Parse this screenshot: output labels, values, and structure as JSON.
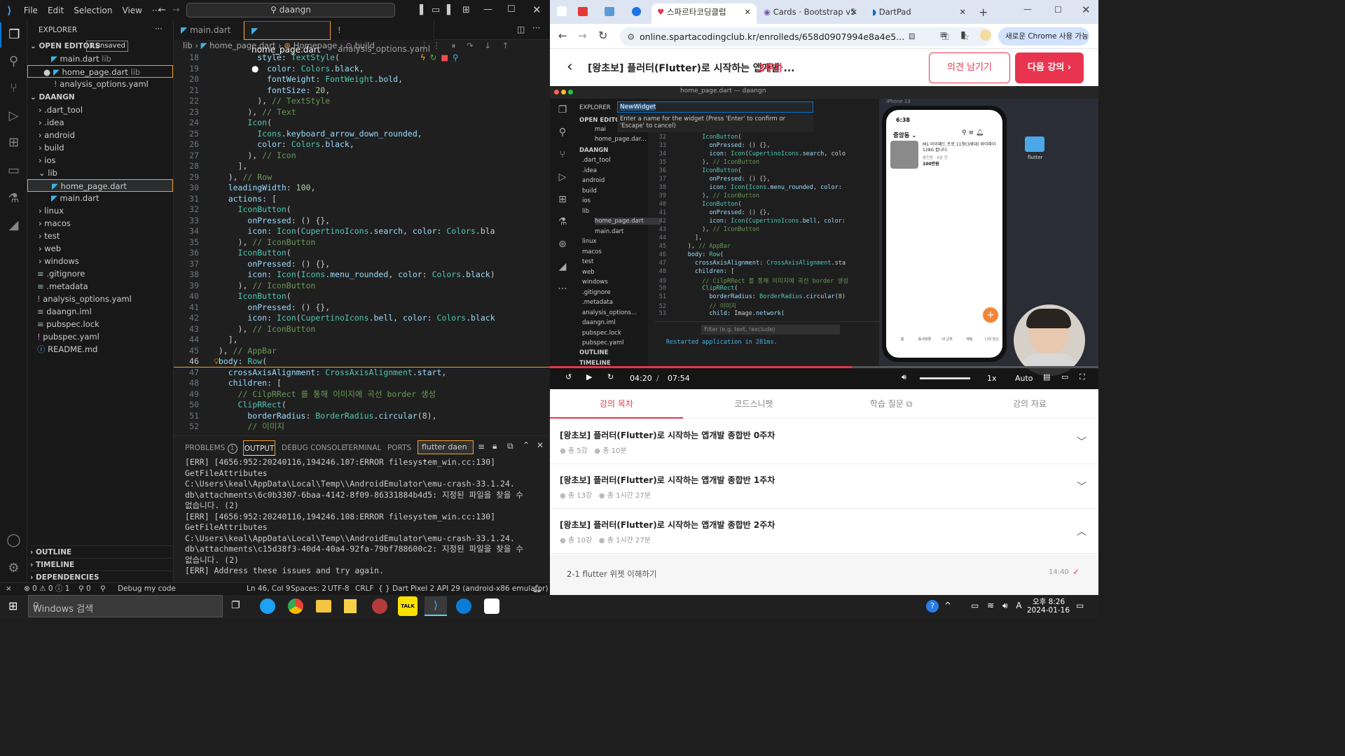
{
  "vscode": {
    "menu": [
      "File",
      "Edit",
      "Selection",
      "View",
      "···"
    ],
    "search": "daangn",
    "explorer": {
      "title": "EXPLORER",
      "open_editors": "OPEN EDITORS",
      "unsaved": "1 unsaved",
      "open_files": [
        {
          "name": "main.dart",
          "hint": "lib"
        },
        {
          "name": "home_page.dart",
          "hint": "lib"
        },
        {
          "name": "analysis_options.yaml",
          "hint": ""
        }
      ],
      "project": "DAANGN",
      "tree": [
        ".dart_tool",
        ".idea",
        "android",
        "build",
        "ios",
        "lib",
        "home_page.dart",
        "main.dart",
        "linux",
        "macos",
        "test",
        "web",
        "windows",
        ".gitignore",
        ".metadata",
        "analysis_options.yaml",
        "daangn.iml",
        "pubspec.lock",
        "pubspec.yaml",
        "README.md"
      ],
      "outline": "OUTLINE",
      "timeline": "TIMELINE",
      "dependencies": "DEPENDENCIES"
    },
    "tabs": [
      "main.dart",
      "home_page.dart",
      "analysis_options.yaml"
    ],
    "breadcrumb": [
      "lib",
      "home_page.dart",
      "Homepage",
      "build"
    ],
    "line_numbers": [
      "18",
      "19",
      "20",
      "21",
      "22",
      "23",
      "24",
      "25",
      "26",
      "27",
      "28",
      "29",
      "30",
      "31",
      "32",
      "33",
      "34",
      "35",
      "36",
      "37",
      "38",
      "39",
      "40",
      "41",
      "42",
      "43",
      "44",
      "45",
      "46",
      "47",
      "48",
      "49",
      "50",
      "51",
      "52"
    ],
    "code": [
      "          style: TextStyle(",
      "            color: Colors.black,",
      "            fontWeight: FontWeight.bold,",
      "            fontSize: 20,",
      "          ), // TextStyle",
      "        ), // Text",
      "        Icon(",
      "          Icons.keyboard_arrow_down_rounded,",
      "          color: Colors.black,",
      "        ), // Icon",
      "      ],",
      "    ), // Row",
      "    leadingWidth: 100,",
      "    actions: [",
      "      IconButton(",
      "        onPressed: () {},",
      "        icon: Icon(CupertinoIcons.search, color: Colors.bla",
      "      ), // IconButton",
      "      IconButton(",
      "        onPressed: () {},",
      "        icon: Icon(Icons.menu_rounded, color: Colors.black)",
      "      ), // IconButton",
      "      IconButton(",
      "        onPressed: () {},",
      "        icon: Icon(CupertinoIcons.bell, color: Colors.black",
      "      ), // IconButton",
      "    ],",
      "  ), // AppBar",
      "  body: Row(",
      "    crossAxisAlignment: CrossAxisAlignment.start,",
      "    children: [",
      "      // CilpRRect 를 통해 이미지에 곡선 border 생성",
      "      ClipRRect(",
      "        borderRadius: BorderRadius.circular(8),",
      "        // 이미지"
    ],
    "panel_tabs": [
      "PROBLEMS",
      "OUTPUT",
      "DEBUG CONSOLE",
      "TERMINAL",
      "PORTS"
    ],
    "problems_count": "1",
    "output_select": "flutter daen",
    "output": [
      "[ERR] [4656:952:20240116,194246.107:ERROR filesystem_win.cc:130]",
      "GetFileAttributes",
      "C:\\Users\\keal\\AppData\\Local\\Temp\\\\AndroidEmulator\\emu-crash-33.1.24.",
      "db\\attachments\\6c0b3307-6baa-4142-8f09-86331884b4d5: 지정된 파일을 찾을 수",
      "없습니다. (2)",
      "[ERR] [4656:952:20240116,194246.108:ERROR filesystem_win.cc:130]",
      "GetFileAttributes",
      "C:\\Users\\keal\\AppData\\Local\\Temp\\\\AndroidEmulator\\emu-crash-33.1.24.",
      "db\\attachments\\c15d38f3-40d4-40a4-92fa-79bf788600c2: 지정된 파일을 찾을 수",
      "없습니다. (2)",
      "[ERR] Address these issues and try again."
    ],
    "status": {
      "problems": "⊗ 0 ⚠ 0 ⓘ 1",
      "ports": "⚲ 0",
      "debug": "Debug my code",
      "cursor": "Ln 46, Col 9",
      "spaces": "Spaces: 2",
      "encoding": "UTF-8",
      "eol": "CRLF",
      "language": "{ } Dart",
      "device": "Pixel 2 API 29 (android-x86 emulator)"
    }
  },
  "chrome": {
    "tabs": [
      "",
      "",
      "",
      "스파르타코딩클럽",
      "Cards · Bootstrap v5",
      "DartPad"
    ],
    "url": "online.spartacodingclub.kr/enrolleds/658d0907994e8a4e5...",
    "profile_btn": "새로운 Chrome 사용 가능",
    "course_title": "[왕초보] 플러터(Flutter)로 시작하는 앱개발 ...",
    "week": "2주차",
    "feedback_btn": "의견 남기기",
    "next_btn": "다음 강의 ›",
    "video": {
      "window_title": "home_page.dart — daangn",
      "explorer": "EXPLORER",
      "rename_value": "NewWidget",
      "rename_hint": "Enter a name for the widget (Press 'Enter' to confirm or 'Escape' to cancel)",
      "open_editors": "OPEN EDITO",
      "open_files": [
        "mai",
        "home_page.dar..."
      ],
      "project": "DAANGN",
      "tree": [
        ".dart_tool",
        ".idea",
        "android",
        "build",
        "ios",
        "lib",
        "home_page.dart",
        "main.dart",
        "linux",
        "macos",
        "test",
        "web",
        "windows",
        ".gitignore",
        ".metadata",
        "analysis_options...",
        "daangn.iml",
        "pubspec.lock",
        "pubspec.yaml"
      ],
      "outline": "OUTLINE",
      "timeline": "TIMELINE",
      "line_numbers": [
        "32",
        "33",
        "34",
        "35",
        "36",
        "37",
        "38",
        "39",
        "40",
        "41",
        "42",
        "43",
        "44",
        "45",
        "46",
        "47",
        "48",
        "49",
        "50",
        "51",
        "52",
        "53"
      ],
      "code": [
        "        IconButton(",
        "          onPressed: () {},",
        "          icon: Icon(CupertinoIcons.search, colo",
        "        ), // IconButton",
        "        IconButton(",
        "          onPressed: () {},",
        "          icon: Icon(Icons.menu_rounded, color:",
        "        ), // IconButton",
        "        IconButton(",
        "          onPressed: () {},",
        "          icon: Icon(CupertinoIcons.bell, color:",
        "        ), // IconButton",
        "      ],",
        "    ), // AppBar",
        "    body: Row(",
        "      crossAxisAlignment: CrossAxisAlignment.sta",
        "      children: [",
        "        // CilpRRect 를 통해 이미지에 곡선 border 생성",
        "        ClipRRect(",
        "          borderRadius: BorderRadius.circular(8)",
        "          // 이미지",
        "          child: Image.network("
      ],
      "filter_placeholder": "Filter (e.g. text, !exclude)",
      "restart_msg": "Restarted application in 281ms.",
      "phone_time": "6:38",
      "phone_location": "중앙동 ⌄",
      "phone_item_title": "M1 아이패드 프로 11형(3세대) 와이파이 128G 팝니다.",
      "phone_item_sub": "봉천동 · 6분 전",
      "phone_item_price": "100만원",
      "phone_nav": [
        "홈",
        "동네생활",
        "내 근처",
        "채팅",
        "나의 당근"
      ],
      "desktop_folder": "flutter",
      "sim_label": "iPhone 13",
      "time_current": "04:20",
      "time_total": "07:54",
      "speed": "1x",
      "quality": "Auto",
      "progress": 0.55
    },
    "content_tabs": [
      "강의 목차",
      "코드스니펫",
      "학습 질문",
      "강의 자료"
    ],
    "sections": [
      {
        "title": "[왕초보] 플러터(Flutter)로 시작하는 앱개발 종합반 0주차",
        "lessons": "총 5강",
        "duration": "총 10분"
      },
      {
        "title": "[왕초보] 플러터(Flutter)로 시작하는 앱개발 종합반 1주차",
        "lessons": "총 13강",
        "duration": "총 1시간 27분"
      },
      {
        "title": "[왕초보] 플러터(Flutter)로 시작하는 앱개발 종합반 2주차",
        "lessons": "총 10강",
        "duration": "총 1시간 27분"
      }
    ],
    "lesson": {
      "label": "2-1  flutter 위젯 이해하기",
      "time": "14:40"
    }
  },
  "taskbar": {
    "search_placeholder": "Windows 검색",
    "time": "오후 8:26",
    "date": "2024-01-16"
  },
  "colors": {
    "accent_red": "#e8344e",
    "vscode_blue": "#0078d4",
    "problem_highlight": "#f0a030"
  }
}
